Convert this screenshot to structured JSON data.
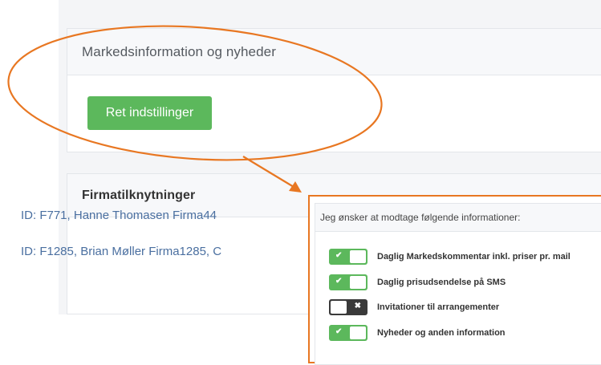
{
  "market_panel": {
    "title": "Markedsinformation og nyheder",
    "button_label": "Ret indstillinger"
  },
  "firm_panel": {
    "title": "Firmatilknytninger",
    "links": [
      "ID: F771, Hanne Thomasen Firma44",
      "ID: F1285, Brian Møller Firma1285, C"
    ]
  },
  "popup": {
    "title": "Jeg ønsker at modtage følgende informationer:",
    "options": [
      {
        "label": "Daglig Markedskommentar inkl. priser pr. mail",
        "enabled": true
      },
      {
        "label": "Daglig prisudsendelse på SMS",
        "enabled": true
      },
      {
        "label": "Invitationer til arrangementer",
        "enabled": false
      },
      {
        "label": "Nyheder og anden information",
        "enabled": true
      }
    ],
    "check_glyph": "✔",
    "cross_glyph": "✖"
  },
  "colors": {
    "accent_orange": "#e87722",
    "button_green": "#5cb85c",
    "link_blue": "#4a6fa0",
    "toggle_off": "#3a3a3a"
  }
}
